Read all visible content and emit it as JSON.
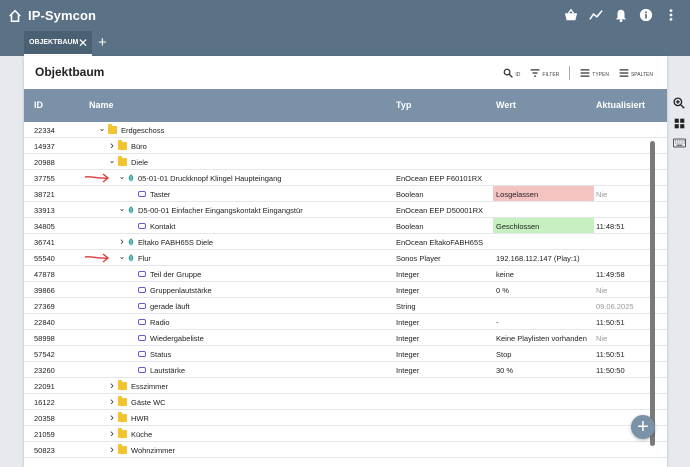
{
  "app": {
    "title": "IP-Symcon"
  },
  "tabs": [
    {
      "label": "OBJEKTBAUM",
      "close": "✕"
    }
  ],
  "add_tab_label": "+",
  "panel": {
    "title": "Objektbaum",
    "actions": {
      "search_label": "ID",
      "filter_label": "FILTER",
      "types_label": "TYPEN",
      "columns_label": "SPALTEN"
    }
  },
  "columns": {
    "id": "ID",
    "name": "Name",
    "typ": "Typ",
    "wert": "Wert",
    "akt": "Aktualisiert"
  },
  "colors": {
    "topbar": "#5a7186",
    "header": "#7a91a8",
    "red_value": "#f6c3c3",
    "green_value": "#c6f0c0",
    "folder": "#f4c430",
    "variable": "#6b5bd6",
    "device": "#2fa39a",
    "arrow": "#e03b3b"
  },
  "rows": [
    {
      "id": "22334",
      "name": "Erdgeschoss",
      "typ": "",
      "wert": "",
      "akt": "",
      "level": 1,
      "icon": "folder",
      "chevron": "down"
    },
    {
      "id": "14937",
      "name": "Büro",
      "typ": "",
      "wert": "",
      "akt": "",
      "level": 2,
      "icon": "folder",
      "chevron": "right"
    },
    {
      "id": "20988",
      "name": "Diele",
      "typ": "",
      "wert": "",
      "akt": "",
      "level": 2,
      "icon": "folder",
      "chevron": "down"
    },
    {
      "id": "37755",
      "name": "05-01-01 Druckknopf Klingel Haupteingang",
      "typ": "EnOcean EEP F60101RX",
      "wert": "",
      "akt": "",
      "level": 3,
      "icon": "device",
      "chevron": "down",
      "arrow": true
    },
    {
      "id": "38721",
      "name": "Taster",
      "typ": "Boolean",
      "wert": "Losgelassen",
      "akt": "Nie",
      "level": 4,
      "icon": "variable",
      "chevron": "",
      "highlight": "red",
      "akt_muted": true
    },
    {
      "id": "33913",
      "name": "D5-00-01 Einfacher Eingangskontakt Eingangstür",
      "typ": "EnOcean EEP D50001RX",
      "wert": "",
      "akt": "",
      "level": 3,
      "icon": "device",
      "chevron": "down"
    },
    {
      "id": "34805",
      "name": "Kontakt",
      "typ": "Boolean",
      "wert": "Geschlossen",
      "akt": "11:48:51",
      "level": 4,
      "icon": "variable",
      "chevron": "",
      "highlight": "green"
    },
    {
      "id": "36741",
      "name": "Eltako FABH65S Diele",
      "typ": "EnOcean EltakoFABH65S",
      "wert": "",
      "akt": "",
      "level": 3,
      "icon": "device",
      "chevron": "right"
    },
    {
      "id": "55540",
      "name": "Flur",
      "typ": "Sonos Player",
      "wert": "192.168.112.147 (Play:1)",
      "akt": "",
      "level": 3,
      "icon": "device",
      "chevron": "down",
      "arrow": true
    },
    {
      "id": "47878",
      "name": "Teil der Gruppe",
      "typ": "Integer",
      "wert": "keine",
      "akt": "11:49:58",
      "level": 4,
      "icon": "variable",
      "chevron": ""
    },
    {
      "id": "39866",
      "name": "Gruppenlautstärke",
      "typ": "Integer",
      "wert": "0 %",
      "akt": "Nie",
      "level": 4,
      "icon": "variable",
      "chevron": "",
      "akt_muted": true
    },
    {
      "id": "27369",
      "name": "gerade läuft",
      "typ": "String",
      "wert": "",
      "akt": "09.06.2025",
      "level": 4,
      "icon": "variable",
      "chevron": "",
      "akt_muted": true
    },
    {
      "id": "22840",
      "name": "Radio",
      "typ": "Integer",
      "wert": "-",
      "akt": "11:50:51",
      "level": 4,
      "icon": "variable",
      "chevron": ""
    },
    {
      "id": "58998",
      "name": "Wiedergabeliste",
      "typ": "Integer",
      "wert": "Keine Playlisten vorhanden",
      "akt": "Nie",
      "level": 4,
      "icon": "variable",
      "chevron": "",
      "akt_muted": true
    },
    {
      "id": "57542",
      "name": "Status",
      "typ": "Integer",
      "wert": "Stop",
      "akt": "11:50:51",
      "level": 4,
      "icon": "variable",
      "chevron": ""
    },
    {
      "id": "23260",
      "name": "Lautstärke",
      "typ": "Integer",
      "wert": "30 %",
      "akt": "11:50:50",
      "level": 4,
      "icon": "variable",
      "chevron": ""
    },
    {
      "id": "22091",
      "name": "Esszimmer",
      "typ": "",
      "wert": "",
      "akt": "",
      "level": 2,
      "icon": "folder",
      "chevron": "right"
    },
    {
      "id": "16122",
      "name": "Gäste WC",
      "typ": "",
      "wert": "",
      "akt": "",
      "level": 2,
      "icon": "folder",
      "chevron": "right"
    },
    {
      "id": "20358",
      "name": "HWR",
      "typ": "",
      "wert": "",
      "akt": "",
      "level": 2,
      "icon": "folder",
      "chevron": "right"
    },
    {
      "id": "21059",
      "name": "Küche",
      "typ": "",
      "wert": "",
      "akt": "",
      "level": 2,
      "icon": "folder",
      "chevron": "right"
    },
    {
      "id": "50823",
      "name": "Wohnzimmer",
      "typ": "",
      "wert": "",
      "akt": "",
      "level": 2,
      "icon": "folder",
      "chevron": "right"
    }
  ],
  "fab_label": "+"
}
